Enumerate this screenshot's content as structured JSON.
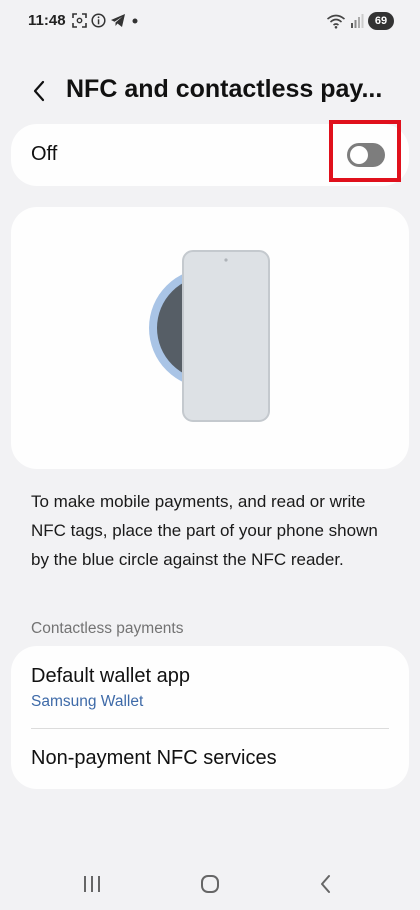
{
  "status_bar": {
    "time": "11:48",
    "battery": "69",
    "left_icons": [
      "screenshot-icon",
      "info-icon",
      "telegram-icon",
      "dot-icon"
    ],
    "right_icons": [
      "wifi-icon",
      "signal-icon",
      "battery-icon"
    ]
  },
  "header": {
    "title": "NFC and contactless pay..."
  },
  "toggle": {
    "label": "Off",
    "state": "off"
  },
  "description": "To make mobile payments, and read or write NFC tags, place the part of your phone shown by the blue circle against the NFC reader.",
  "contactless": {
    "section_title": "Contactless payments",
    "default_wallet": {
      "title": "Default wallet app",
      "value": "Samsung Wallet"
    },
    "non_payment": {
      "title": "Non-payment NFC services"
    }
  },
  "colors": {
    "background": "#f2f2f4",
    "card": "#fefefe",
    "accent_blue": "#3e6aa8",
    "highlight_red": "#e0101c",
    "nfc_ring": "#a9c4e6"
  },
  "nav": {
    "icons": [
      "recent-apps-icon",
      "home-icon",
      "back-icon"
    ]
  }
}
